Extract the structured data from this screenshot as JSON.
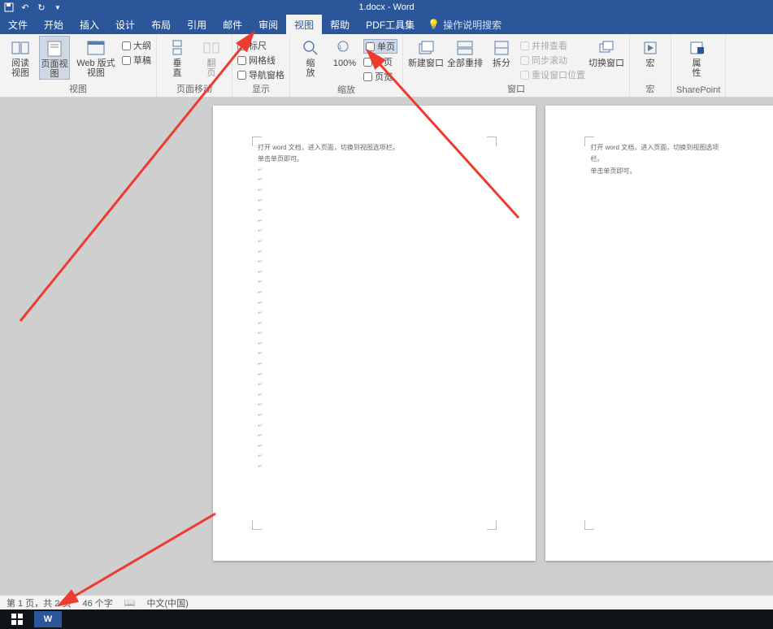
{
  "title": "1.docx - Word",
  "tabs": [
    "文件",
    "开始",
    "插入",
    "设计",
    "布局",
    "引用",
    "邮件",
    "审阅",
    "视图",
    "帮助",
    "PDF工具集"
  ],
  "active_tab_index": 8,
  "tell_me": "操作说明搜索",
  "ribbon": {
    "views": {
      "read": "阅读\n视图",
      "page": "页面视图",
      "web": "Web 版式视图",
      "outline": "大纲",
      "draft": "草稿",
      "group_label": "视图"
    },
    "page_move": {
      "vertical": "垂\n直",
      "flip": "翻\n页",
      "group_label": "页面移动"
    },
    "show": {
      "ruler": "标尺",
      "grid": "网格线",
      "nav": "导航窗格",
      "group_label": "显示"
    },
    "zoom": {
      "zoom": "缩\n放",
      "hundred": "100%",
      "single": "单页",
      "multi": "多页",
      "width": "页宽",
      "group_label": "缩放"
    },
    "window": {
      "new": "新建窗口",
      "all": "全部重排",
      "split": "拆分",
      "side": "并排查看",
      "sync": "同步滚动",
      "reset": "重设窗口位置",
      "switch": "切换窗口",
      "group_label": "窗口"
    },
    "macros": {
      "label": "宏",
      "group_label": "宏"
    },
    "sharepoint": {
      "label": "属\n性",
      "group_label": "SharePoint"
    }
  },
  "document": {
    "line1": "打开 word 文档，进入页面，切换到视图选项栏。",
    "line2": "单击单页即可。"
  },
  "status": {
    "page_info": "第 1 页，共 2 页",
    "word_count": "46 个字",
    "language": "中文(中国)"
  }
}
